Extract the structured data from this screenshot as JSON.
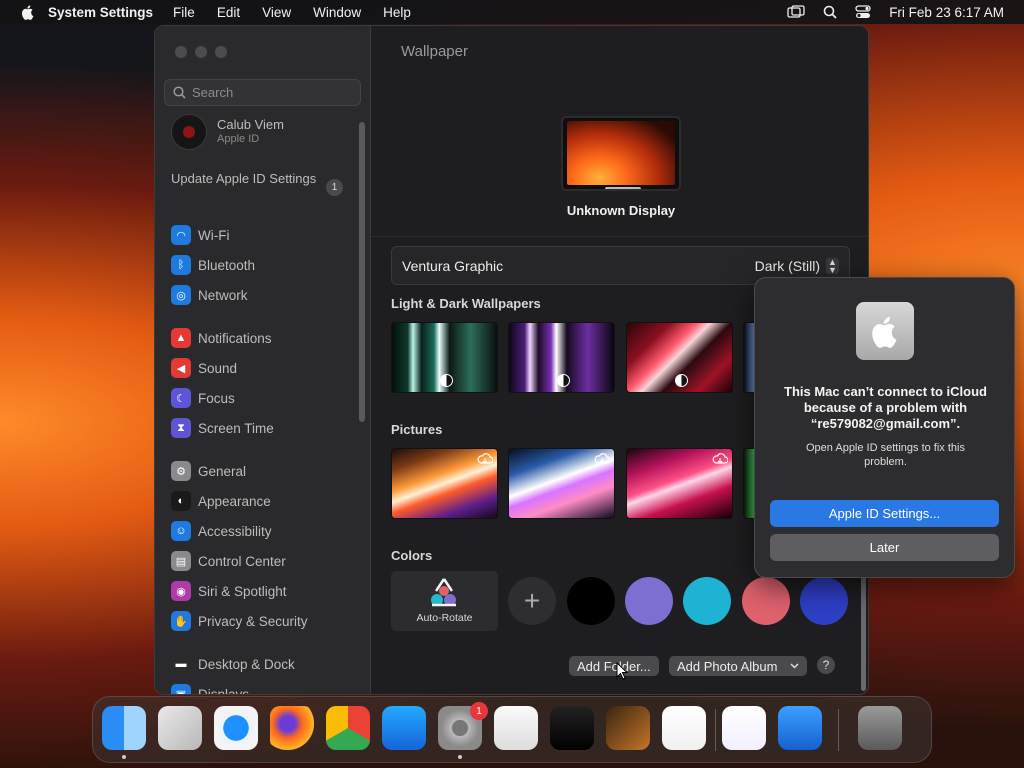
{
  "menubar": {
    "app": "System Settings",
    "menus": [
      "File",
      "Edit",
      "View",
      "Window",
      "Help"
    ],
    "clock": "Fri Feb 23  6:17 AM"
  },
  "sidebar": {
    "search_placeholder": "Search",
    "user": {
      "name": "Calub Viem",
      "sub": "Apple ID"
    },
    "update": {
      "label": "Update Apple ID Settings",
      "badge": "1"
    },
    "items": [
      {
        "label": "Wi-Fi",
        "icon": "wifi-icon",
        "color": "#1f7ae0"
      },
      {
        "label": "Bluetooth",
        "icon": "bluetooth-icon",
        "color": "#1f7ae0"
      },
      {
        "label": "Network",
        "icon": "globe-icon",
        "color": "#1f7ae0"
      },
      {
        "label": "Notifications",
        "icon": "bell-icon",
        "color": "#e53935"
      },
      {
        "label": "Sound",
        "icon": "speaker-icon",
        "color": "#e53935"
      },
      {
        "label": "Focus",
        "icon": "moon-icon",
        "color": "#5e55d6"
      },
      {
        "label": "Screen Time",
        "icon": "hourglass-icon",
        "color": "#5e55d6"
      },
      {
        "label": "General",
        "icon": "gear-icon",
        "color": "#8a8a8c"
      },
      {
        "label": "Appearance",
        "icon": "appearance-icon",
        "color": "#1a1a1a"
      },
      {
        "label": "Accessibility",
        "icon": "accessibility-icon",
        "color": "#1f7ae0"
      },
      {
        "label": "Control Center",
        "icon": "control-center-icon",
        "color": "#8a8a8c"
      },
      {
        "label": "Siri & Spotlight",
        "icon": "siri-icon",
        "color": "#b03aa6"
      },
      {
        "label": "Privacy & Security",
        "icon": "hand-icon",
        "color": "#1f7ae0"
      },
      {
        "label": "Desktop & Dock",
        "icon": "desktop-icon",
        "color": "#2a2a2a"
      },
      {
        "label": "Displays",
        "icon": "display-icon",
        "color": "#1f7ae0"
      }
    ]
  },
  "main": {
    "title": "Wallpaper",
    "display_name": "Unknown Display",
    "wallpaper_name": "Ventura Graphic",
    "wallpaper_mode": "Dark (Still)",
    "sections": {
      "light_dark": "Light & Dark Wallpapers",
      "pictures": "Pictures",
      "colors": "Colors"
    },
    "auto_rotate": "Auto-Rotate",
    "colors": [
      "#000000",
      "#7b6fd0",
      "#1eb3d3",
      "#e0626e",
      "#2f3fc8"
    ],
    "buttons": {
      "add_folder": "Add Folder...",
      "add_album": "Add Photo Album",
      "help": "?"
    }
  },
  "alert": {
    "title": "This Mac can’t connect to iCloud because of a problem with “re579082@gmail.com”.",
    "body": "Open Apple ID settings to fix this problem.",
    "primary_button": "Apple ID Settings...",
    "secondary_button": "Later"
  },
  "dock": {
    "apps": [
      {
        "name": "Finder",
        "icon": "finder-icon",
        "running": true
      },
      {
        "name": "Launchpad",
        "icon": "launchpad-icon",
        "running": false
      },
      {
        "name": "Safari",
        "icon": "safari-icon",
        "running": false
      },
      {
        "name": "Firefox",
        "icon": "firefox-icon",
        "running": false
      },
      {
        "name": "Chrome",
        "icon": "chrome-icon",
        "running": false
      },
      {
        "name": "App Store",
        "icon": "app-store-icon",
        "running": false
      },
      {
        "name": "System Settings",
        "icon": "system-settings-icon",
        "running": true,
        "badge": "1"
      },
      {
        "name": "TextEdit",
        "icon": "textedit-icon",
        "running": false
      },
      {
        "name": "Terminal",
        "icon": "terminal-icon",
        "running": false
      },
      {
        "name": "GarageBand",
        "icon": "garageband-icon",
        "running": false
      },
      {
        "name": "VS Code",
        "icon": "vscode-icon",
        "running": false
      },
      {
        "name": "Visual Studio",
        "icon": "visual-studio-icon",
        "running": false
      },
      {
        "name": "Weather",
        "icon": "weather-icon",
        "running": false
      },
      {
        "name": "Trash",
        "icon": "trash-icon",
        "running": false
      }
    ]
  }
}
